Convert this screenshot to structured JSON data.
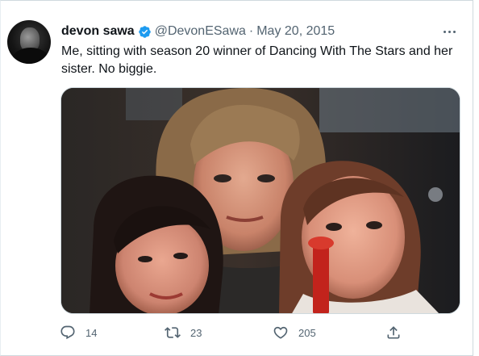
{
  "tweet": {
    "author_name": "devon sawa",
    "handle": "@DevonESawa",
    "separator": "·",
    "date": "May 20, 2015",
    "text": "Me, sitting with season 20 winner of Dancing With The Stars and her sister. No biggie.",
    "verified": true
  },
  "actions": {
    "reply_count": "14",
    "retweet_count": "23",
    "like_count": "205"
  },
  "icons": {
    "verified": "verified-badge-icon",
    "more": "more-dots-icon",
    "reply": "reply-icon",
    "retweet": "retweet-icon",
    "like": "heart-icon",
    "share": "share-icon"
  },
  "colors": {
    "text": "#0f1419",
    "secondary": "#536471",
    "verified": "#1d9bf0",
    "border": "#cfd9de"
  }
}
